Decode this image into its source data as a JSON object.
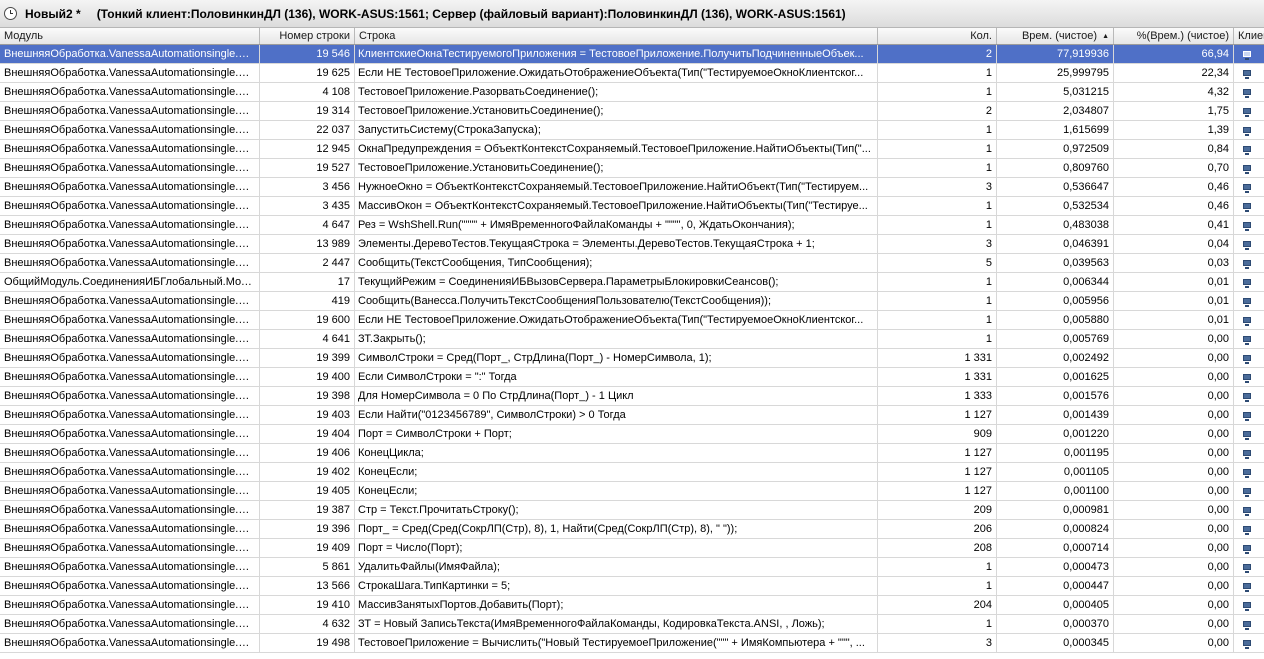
{
  "window": {
    "title": "Новый2 *",
    "subtitle": "(Тонкий клиент:ПоловинкинДЛ (136), WORK-ASUS:1561; Сервер (файловый вариант):ПоловинкинДЛ (136), WORK-ASUS:1561)"
  },
  "columns": {
    "module": "Модуль",
    "line_number": "Номер строки",
    "line": "Строка",
    "count": "Кол.",
    "time_pure": "Врем. (чистое)",
    "time_pct": "%(Врем.) (чистое)",
    "client": "Клиен"
  },
  "sort": {
    "column": "Врем. (чистое)",
    "indicator": "▲"
  },
  "icons": {
    "client_marker": "monitor-icon",
    "window_icon": "clock-icon"
  },
  "rows": [
    {
      "module": "ВнешняяОбработка.VanessaAutomationsingle.Ф...",
      "num": "19 546",
      "line": "КлиентскиеОкнаТестируемогоПриложения = ТестовоеПриложение.ПолучитьПодчиненныеОбъек...",
      "count": "2",
      "time": "77,919936",
      "pct": "66,94",
      "selected": true
    },
    {
      "module": "ВнешняяОбработка.VanessaAutomationsingle.Ф...",
      "num": "19 625",
      "line": "Если НЕ ТестовоеПриложение.ОжидатьОтображениеОбъекта(Тип(\"ТестируемоеОкноКлиентског...",
      "count": "1",
      "time": "25,999795",
      "pct": "22,34"
    },
    {
      "module": "ВнешняяОбработка.VanessaAutomationsingle.Ф...",
      "num": "4 108",
      "line": "ТестовоеПриложение.РазорватьСоединение();",
      "count": "1",
      "time": "5,031215",
      "pct": "4,32"
    },
    {
      "module": "ВнешняяОбработка.VanessaAutomationsingle.Ф...",
      "num": "19 314",
      "line": "ТестовоеПриложение.УстановитьСоединение();",
      "count": "2",
      "time": "2,034807",
      "pct": "1,75"
    },
    {
      "module": "ВнешняяОбработка.VanessaAutomationsingle.Ф...",
      "num": "22 037",
      "line": "ЗапуститьСистему(СтрокаЗапуска);",
      "count": "1",
      "time": "1,615699",
      "pct": "1,39"
    },
    {
      "module": "ВнешняяОбработка.VanessaAutomationsingle.Ф...",
      "num": "12 945",
      "line": "ОкнаПредупреждения = ОбъектКонтекстСохраняемый.ТестовоеПриложение.НайтиОбъекты(Тип(\"...",
      "count": "1",
      "time": "0,972509",
      "pct": "0,84"
    },
    {
      "module": "ВнешняяОбработка.VanessaAutomationsingle.Ф...",
      "num": "19 527",
      "line": "ТестовоеПриложение.УстановитьСоединение();",
      "count": "1",
      "time": "0,809760",
      "pct": "0,70"
    },
    {
      "module": "ВнешняяОбработка.VanessaAutomationsingle.Ф...",
      "num": "3 456",
      "line": "НужноеОкно = ОбъектКонтекстСохраняемый.ТестовоеПриложение.НайтиОбъект(Тип(\"Тестируем...",
      "count": "3",
      "time": "0,536647",
      "pct": "0,46"
    },
    {
      "module": "ВнешняяОбработка.VanessaAutomationsingle.Ф...",
      "num": "3 435",
      "line": "МассивОкон = ОбъектКонтекстСохраняемый.ТестовоеПриложение.НайтиОбъекты(Тип(\"Тестируе...",
      "count": "1",
      "time": "0,532534",
      "pct": "0,46"
    },
    {
      "module": "ВнешняяОбработка.VanessaAutomationsingle.Ф...",
      "num": "4 647",
      "line": "Рез = WshShell.Run(\"\"\"\" + ИмяВременногоФайлаКоманды + \"\"\"\", 0, ЖдатьОкончания);",
      "count": "1",
      "time": "0,483038",
      "pct": "0,41"
    },
    {
      "module": "ВнешняяОбработка.VanessaAutomationsingle.Ф...",
      "num": "13 989",
      "line": "Элементы.ДеревоТестов.ТекущаяСтрока = Элементы.ДеревоТестов.ТекущаяСтрока + 1;",
      "count": "3",
      "time": "0,046391",
      "pct": "0,04"
    },
    {
      "module": "ВнешняяОбработка.VanessaAutomationsingle.Ф...",
      "num": "2 447",
      "line": "Сообщить(ТекстСообщения, ТипСообщения);",
      "count": "5",
      "time": "0,039563",
      "pct": "0,03"
    },
    {
      "module": "ОбщийМодуль.СоединенияИБГлобальный.Мод...",
      "num": "17",
      "line": "ТекущийРежим = СоединенияИБВызовСервера.ПараметрыБлокировкиСеансов();",
      "count": "1",
      "time": "0,006344",
      "pct": "0,01"
    },
    {
      "module": "ВнешняяОбработка.VanessaAutomationsingle.Ф...",
      "num": "419",
      "line": "Сообщить(Ванесса.ПолучитьТекстСообщенияПользователю(ТекстСообщения));",
      "count": "1",
      "time": "0,005956",
      "pct": "0,01"
    },
    {
      "module": "ВнешняяОбработка.VanessaAutomationsingle.Ф...",
      "num": "19 600",
      "line": "Если НЕ ТестовоеПриложение.ОжидатьОтображениеОбъекта(Тип(\"ТестируемоеОкноКлиентског...",
      "count": "1",
      "time": "0,005880",
      "pct": "0,01"
    },
    {
      "module": "ВнешняяОбработка.VanessaAutomationsingle.Ф...",
      "num": "4 641",
      "line": "ЗТ.Закрыть();",
      "count": "1",
      "time": "0,005769",
      "pct": "0,00"
    },
    {
      "module": "ВнешняяОбработка.VanessaAutomationsingle.Ф...",
      "num": "19 399",
      "line": "СимволСтроки = Сред(Порт_, СтрДлина(Порт_) - НомерСимвола, 1);",
      "count": "1 331",
      "time": "0,002492",
      "pct": "0,00"
    },
    {
      "module": "ВнешняяОбработка.VanessaAutomationsingle.Ф...",
      "num": "19 400",
      "line": "Если СимволСтроки = \":\" Тогда",
      "count": "1 331",
      "time": "0,001625",
      "pct": "0,00"
    },
    {
      "module": "ВнешняяОбработка.VanessaAutomationsingle.Ф...",
      "num": "19 398",
      "line": "Для НомерСимвола = 0 По СтрДлина(Порт_) - 1 Цикл",
      "count": "1 333",
      "time": "0,001576",
      "pct": "0,00"
    },
    {
      "module": "ВнешняяОбработка.VanessaAutomationsingle.Ф...",
      "num": "19 403",
      "line": "Если Найти(\"0123456789\", СимволСтроки) > 0 Тогда",
      "count": "1 127",
      "time": "0,001439",
      "pct": "0,00"
    },
    {
      "module": "ВнешняяОбработка.VanessaAutomationsingle.Ф...",
      "num": "19 404",
      "line": "Порт = СимволСтроки + Порт;",
      "count": "909",
      "time": "0,001220",
      "pct": "0,00"
    },
    {
      "module": "ВнешняяОбработка.VanessaAutomationsingle.Ф...",
      "num": "19 406",
      "line": "КонецЦикла;",
      "count": "1 127",
      "time": "0,001195",
      "pct": "0,00"
    },
    {
      "module": "ВнешняяОбработка.VanessaAutomationsingle.Ф...",
      "num": "19 402",
      "line": "КонецЕсли;",
      "count": "1 127",
      "time": "0,001105",
      "pct": "0,00"
    },
    {
      "module": "ВнешняяОбработка.VanessaAutomationsingle.Ф...",
      "num": "19 405",
      "line": "КонецЕсли;",
      "count": "1 127",
      "time": "0,001100",
      "pct": "0,00"
    },
    {
      "module": "ВнешняяОбработка.VanessaAutomationsingle.Ф...",
      "num": "19 387",
      "line": "Стр = Текст.ПрочитатьСтроку();",
      "count": "209",
      "time": "0,000981",
      "pct": "0,00"
    },
    {
      "module": "ВнешняяОбработка.VanessaAutomationsingle.Ф...",
      "num": "19 396",
      "line": "Порт_ = Сред(Сред(СокрЛП(Стр), 8), 1, Найти(Сред(СокрЛП(Стр), 8), \"  \"));",
      "count": "206",
      "time": "0,000824",
      "pct": "0,00"
    },
    {
      "module": "ВнешняяОбработка.VanessaAutomationsingle.Ф...",
      "num": "19 409",
      "line": "Порт = Число(Порт);",
      "count": "208",
      "time": "0,000714",
      "pct": "0,00"
    },
    {
      "module": "ВнешняяОбработка.VanessaAutomationsingle.Ф...",
      "num": "5 861",
      "line": "УдалитьФайлы(ИмяФайла);",
      "count": "1",
      "time": "0,000473",
      "pct": "0,00"
    },
    {
      "module": "ВнешняяОбработка.VanessaAutomationsingle.Ф...",
      "num": "13 566",
      "line": "СтрокаШага.ТипКартинки = 5;",
      "count": "1",
      "time": "0,000447",
      "pct": "0,00"
    },
    {
      "module": "ВнешняяОбработка.VanessaAutomationsingle.Ф...",
      "num": "19 410",
      "line": "МассивЗанятыхПортов.Добавить(Порт);",
      "count": "204",
      "time": "0,000405",
      "pct": "0,00"
    },
    {
      "module": "ВнешняяОбработка.VanessaAutomationsingle.Ф...",
      "num": "4 632",
      "line": "ЗТ = Новый ЗаписьТекста(ИмяВременногоФайлаКоманды, КодировкаТекста.ANSI, , Ложь);",
      "count": "1",
      "time": "0,000370",
      "pct": "0,00"
    },
    {
      "module": "ВнешняяОбработка.VanessaAutomationsingle.Ф...",
      "num": "19 498",
      "line": "ТестовоеПриложение = Вычислить(\"Новый ТестируемоеПриложение(\"\"\" + ИмяКомпьютера + \"\"\", ...",
      "count": "3",
      "time": "0,000345",
      "pct": "0,00"
    }
  ]
}
